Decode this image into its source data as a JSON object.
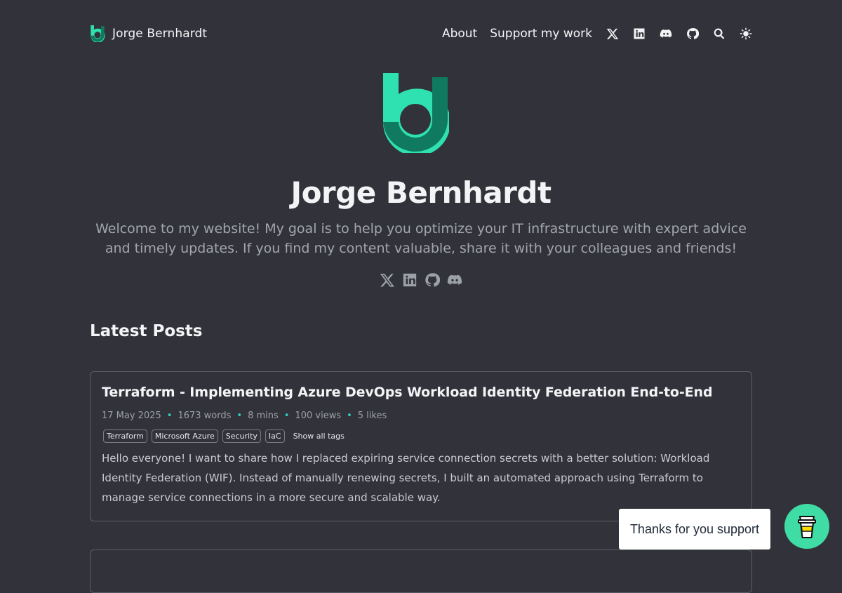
{
  "header": {
    "brand_name": "Jorge Bernhardt",
    "nav_links": [
      "About",
      "Support my work"
    ],
    "icons": [
      "x-icon",
      "linkedin-icon",
      "discord-icon",
      "github-icon",
      "search-icon",
      "theme-toggle-icon"
    ]
  },
  "hero": {
    "title": "Jorge Bernhardt",
    "description": "Welcome to my website! My goal is to help you optimize your IT infrastructure with expert advice and timely updates. If you find my content valuable, share it with your colleagues and friends!",
    "social_icons": [
      "x-icon",
      "linkedin-icon",
      "github-icon",
      "discord-icon"
    ]
  },
  "latest_posts": {
    "heading": "Latest Posts",
    "posts": [
      {
        "title": "Terraform - Implementing Azure DevOps Workload Identity Federation End-to-End",
        "date": "17 May 2025",
        "words": "1673 words",
        "read_time": "8 mins",
        "views": "100 views",
        "likes": "5 likes",
        "tags": [
          "Terraform",
          "Microsoft Azure",
          "Security",
          "IaC"
        ],
        "show_tags_label": "Show all tags",
        "excerpt": "Hello everyone! I want to share how I replaced expiring service connection secrets with a better solution: Workload Identity Federation (WIF). Instead of manually renewing secrets, I built an automated approach using Terraform to manage service connections in a more secure and scalable way."
      }
    ]
  },
  "support_widget": {
    "tooltip": "Thanks for you support",
    "icon": "coffee-cup-icon"
  },
  "colors": {
    "background": "#32333a",
    "accent": "#40dca5",
    "accent_dark": "#0f7a5f",
    "text": "#f3f4f6",
    "muted": "#a3a6ad"
  }
}
